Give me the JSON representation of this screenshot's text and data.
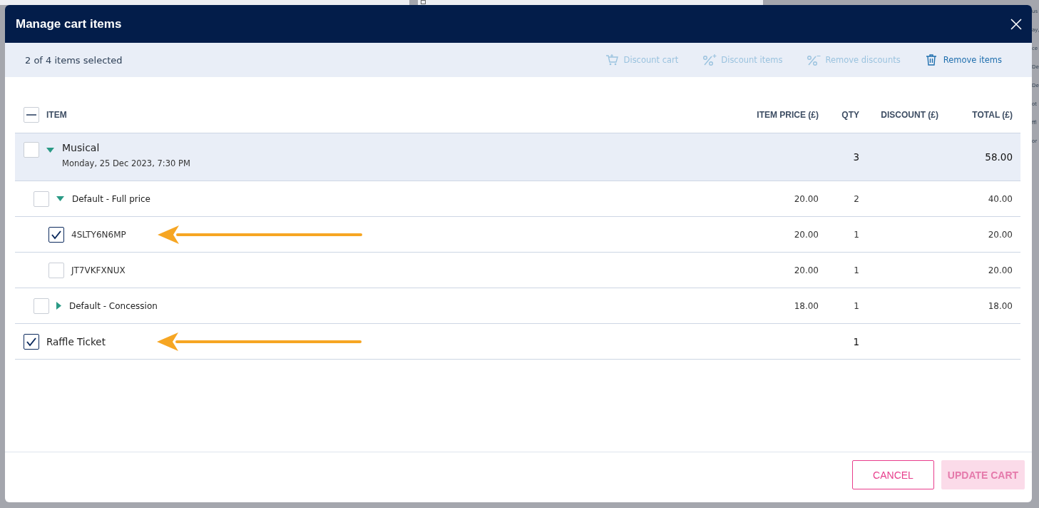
{
  "background": {
    "side_fragments": [
      "us",
      "ay,",
      "ce",
      "De",
      "De",
      "ot",
      "ffl",
      "or"
    ]
  },
  "dialog": {
    "title": "Manage cart items",
    "selection_summary": "2 of 4 items selected",
    "actions": [
      {
        "kind": "cart-discount",
        "label": "Discount cart",
        "disabled": true
      },
      {
        "kind": "percent-plus",
        "label": "Discount items",
        "disabled": true
      },
      {
        "kind": "percent-minus",
        "label": "Remove discounts",
        "disabled": true
      },
      {
        "kind": "trash",
        "label": "Remove items",
        "disabled": false
      }
    ],
    "select_all": {
      "indeterminate": true
    },
    "columns": [
      "ITEM",
      "ITEM PRICE (£)",
      "QTY",
      "DISCOUNT (£)",
      "TOTAL (£)"
    ],
    "rows": [
      {
        "kind": "event",
        "name": "Musical",
        "date": "Monday, 25 Dec 2023, 7:30 PM",
        "qty": "3",
        "total": "58.00",
        "checked": false,
        "expanded": true,
        "annotated": false,
        "children": [
          {
            "kind": "price-band",
            "name": "Default - Full price",
            "price": "20.00",
            "qty": "2",
            "total": "40.00",
            "checked": false,
            "expanded": true,
            "annotated": false,
            "children": [
              {
                "kind": "ticket",
                "name": "4SLTY6N6MP",
                "price": "20.00",
                "qty": "1",
                "total": "20.00",
                "checked": true,
                "annotated": true
              },
              {
                "kind": "ticket",
                "name": "JT7VKFXNUX",
                "price": "20.00",
                "qty": "1",
                "total": "20.00",
                "checked": false,
                "annotated": false
              }
            ]
          },
          {
            "kind": "price-band",
            "name": "Default - Concession",
            "price": "18.00",
            "qty": "1",
            "total": "18.00",
            "checked": false,
            "expanded": false,
            "annotated": false
          }
        ]
      },
      {
        "kind": "product",
        "name": "Raffle Ticket",
        "qty": "1",
        "checked": true,
        "annotated": true
      }
    ],
    "buttons": [
      {
        "kind": "secondary",
        "label": "CANCEL",
        "disabled": false
      },
      {
        "kind": "primary",
        "label": "UPDATE CART",
        "disabled": true
      }
    ]
  }
}
